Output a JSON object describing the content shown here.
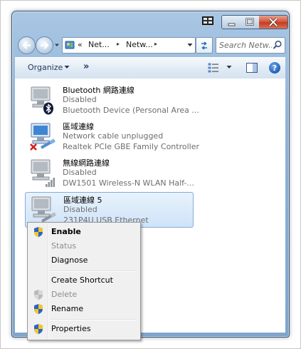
{
  "window": {
    "caption": {
      "minimize_glyph": "–",
      "maximize_glyph": "□",
      "close_glyph": "✕"
    }
  },
  "nav": {
    "address": {
      "prefix": "«",
      "crumbs": [
        "Net...",
        "Netw..."
      ],
      "separator": "▸"
    },
    "search": {
      "placeholder": "Search Netw..."
    }
  },
  "toolbar": {
    "organize_label": "Organize",
    "overflow_label": "»",
    "help_label": "?"
  },
  "connections": [
    {
      "name": "Bluetooth 網路連線",
      "status": "Disabled",
      "device": "Bluetooth Device (Personal Area ...",
      "badge": "bluetooth-icon",
      "selected": false
    },
    {
      "name": "區域連線",
      "status": "Network cable unplugged",
      "device": "Realtek PCIe GBE Family Controller",
      "badge": "red-x-icon",
      "selected": false
    },
    {
      "name": "無線網路連線",
      "status": "Disabled",
      "device": "DW1501 Wireless-N WLAN Half-...",
      "badge": "signal-bars-icon",
      "selected": false
    },
    {
      "name": "區域連線 5",
      "status": "Disabled",
      "device": "231P4U USB Ethernet",
      "badge": "ethernet-cable-icon",
      "selected": true
    }
  ],
  "context_menu": {
    "items": [
      {
        "label": "Enable",
        "shield": "color",
        "bold": true,
        "disabled": false
      },
      {
        "label": "Status",
        "shield": "none",
        "bold": false,
        "disabled": true
      },
      {
        "label": "Diagnose",
        "shield": "none",
        "bold": false,
        "disabled": false
      },
      {
        "label": "Create Shortcut",
        "shield": "none",
        "bold": false,
        "disabled": false
      },
      {
        "label": "Delete",
        "shield": "gray",
        "bold": false,
        "disabled": true
      },
      {
        "label": "Rename",
        "shield": "color",
        "bold": false,
        "disabled": false
      },
      {
        "label": "Properties",
        "shield": "color",
        "bold": false,
        "disabled": false
      }
    ]
  },
  "colors": {
    "selection_fill": "#cfe3f8",
    "selection_border": "#84acdd",
    "shield_blue": "#2b63c6",
    "shield_yellow": "#f3c623",
    "disabled_text": "#8d8d8d"
  }
}
